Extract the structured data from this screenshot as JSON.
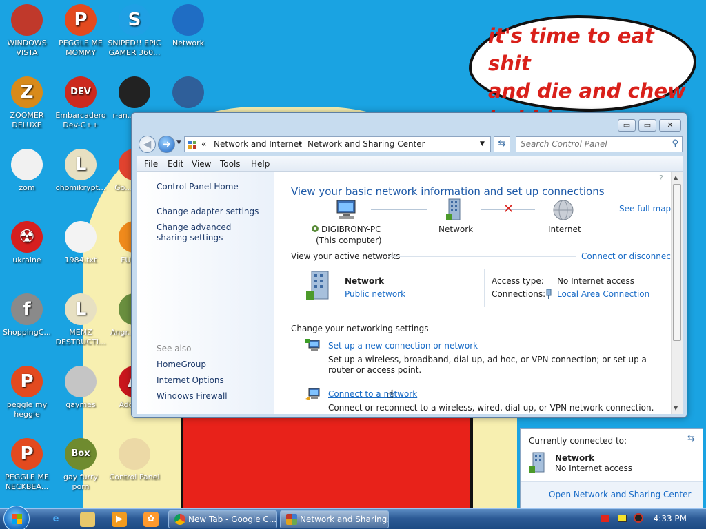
{
  "wallpaper": {
    "speech_bubble": [
      "it's time to eat shit",
      "and die and chew",
      "bubble gum"
    ]
  },
  "desktop_icons": [
    {
      "label": "WINDOWS VISTA",
      "icon": "vista-icon",
      "color": "#c0392b",
      "glyph": ""
    },
    {
      "label": "PEGGLE ME MOMMY",
      "icon": "peggle-icon",
      "color": "#e34a1f",
      "glyph": "P"
    },
    {
      "label": "SNIPED!! EPIC GAMER 360...",
      "icon": "skype-icon",
      "color": "#1fa0e4",
      "glyph": "S"
    },
    {
      "label": "Network",
      "icon": "network-icon",
      "color": "#1f6dc4",
      "glyph": ""
    },
    {
      "label": "ZOOMER DELUXE",
      "icon": "zuma-icon",
      "color": "#d88a1a",
      "glyph": "Z"
    },
    {
      "label": "Embarcadero Dev-C++",
      "icon": "devcpp-icon",
      "color": "#cc2a1f",
      "glyph": "DEV"
    },
    {
      "label": "r-an... par...",
      "icon": "app-icon",
      "color": "#222222",
      "glyph": ""
    },
    {
      "label": "",
      "icon": "monitor-icon",
      "color": "#2f5f9a",
      "glyph": ""
    },
    {
      "label": "zom",
      "icon": "flower-icon",
      "color": "#f1f1f1",
      "glyph": ""
    },
    {
      "label": "chomikrypt...",
      "icon": "shortcut-icon",
      "color": "#e7e0c2",
      "glyph": "L"
    },
    {
      "label": "Go... Chr...",
      "icon": "chrome-icon",
      "color": "#e1432f",
      "glyph": ""
    },
    {
      "label": "ukraine",
      "icon": "radiation-icon",
      "color": "#d61f1f",
      "glyph": "☢"
    },
    {
      "label": "1984.txt",
      "icon": "text-file-icon",
      "color": "#f3f3f3",
      "glyph": ""
    },
    {
      "label": "FURR...",
      "icon": "firefox-icon",
      "color": "#f08a1c",
      "glyph": ""
    },
    {
      "label": "ShoppingC...",
      "icon": "flash-icon",
      "color": "#8a8a8a",
      "glyph": "f"
    },
    {
      "label": "MEMZ DESTRUCTI...",
      "icon": "shortcut-icon",
      "color": "#e7e0c2",
      "glyph": "L"
    },
    {
      "label": "Angr... Sea...",
      "icon": "angry-birds-icon",
      "color": "#6a8f3f",
      "glyph": ""
    },
    {
      "label": "peggle my heggle",
      "icon": "peggle-icon",
      "color": "#e34a1f",
      "glyph": "P"
    },
    {
      "label": "gaymes",
      "icon": "games-folder-icon",
      "color": "#c5c5c5",
      "glyph": ""
    },
    {
      "label": "Adobe...",
      "icon": "adobe-icon",
      "color": "#c9161d",
      "glyph": "A"
    },
    {
      "label": "PEGGLE ME NECKBEA...",
      "icon": "peggle-icon",
      "color": "#e34a1f",
      "glyph": "P"
    },
    {
      "label": "gay furry porn",
      "icon": "box-game-icon",
      "color": "#6f8b2f",
      "glyph": "Box"
    },
    {
      "label": "Control Panel",
      "icon": "control-panel-icon",
      "color": "#ecd9a6",
      "glyph": ""
    }
  ],
  "window": {
    "controls": {
      "minimize": "▭",
      "maximize": "▭",
      "close": "✕"
    },
    "address": {
      "chevrons": "«",
      "crumb1": "Network and Internet",
      "sep": "▸",
      "crumb2": "Network and Sharing Center"
    },
    "search_placeholder": "Search Control Panel",
    "menu": [
      "File",
      "Edit",
      "View",
      "Tools",
      "Help"
    ],
    "left_pane": {
      "links": [
        "Control Panel Home",
        "Change adapter settings",
        "Change advanced sharing settings"
      ],
      "see_also_title": "See also",
      "see_also": [
        "HomeGroup",
        "Internet Options",
        "Windows Firewall"
      ]
    },
    "main": {
      "heading": "View your basic network information and set up connections",
      "see_full_map": "See full map",
      "map": {
        "computer_name": "DIGIBRONY-PC",
        "computer_sub": "(This computer)",
        "network": "Network",
        "internet": "Internet"
      },
      "active_networks_title": "View your active networks",
      "connect_or_disconnect": "Connect or disconnect",
      "active_network": {
        "name": "Network",
        "type_link": "Public network",
        "access_type_label": "Access type:",
        "access_type_value": "No Internet access",
        "connections_label": "Connections:",
        "connections_value": "Local Area Connection"
      },
      "change_settings_title": "Change your networking settings",
      "tasks": [
        {
          "link": "Set up a new connection or network",
          "desc": "Set up a wireless, broadband, dial-up, ad hoc, or VPN connection; or set up a router or access point."
        },
        {
          "link": "Connect to a network",
          "desc": "Connect or reconnect to a wireless, wired, dial-up, or VPN network connection."
        }
      ]
    }
  },
  "flyout": {
    "title": "Currently connected to:",
    "network_name": "Network",
    "network_status": "No Internet access",
    "footer_link": "Open Network and Sharing Center"
  },
  "taskbar": {
    "tasks": [
      {
        "label": "New Tab - Google C...",
        "icon": "chrome-icon"
      },
      {
        "label": "Network and Sharing...",
        "icon": "control-panel-icon"
      }
    ],
    "clock": "4:33 PM"
  },
  "colors": {
    "desktop": "#1aa3e2",
    "link": "#1a6cc7",
    "heading": "#1e5aa8",
    "bubble_text": "#d9201a",
    "disconnected_x": "#d9231d"
  }
}
